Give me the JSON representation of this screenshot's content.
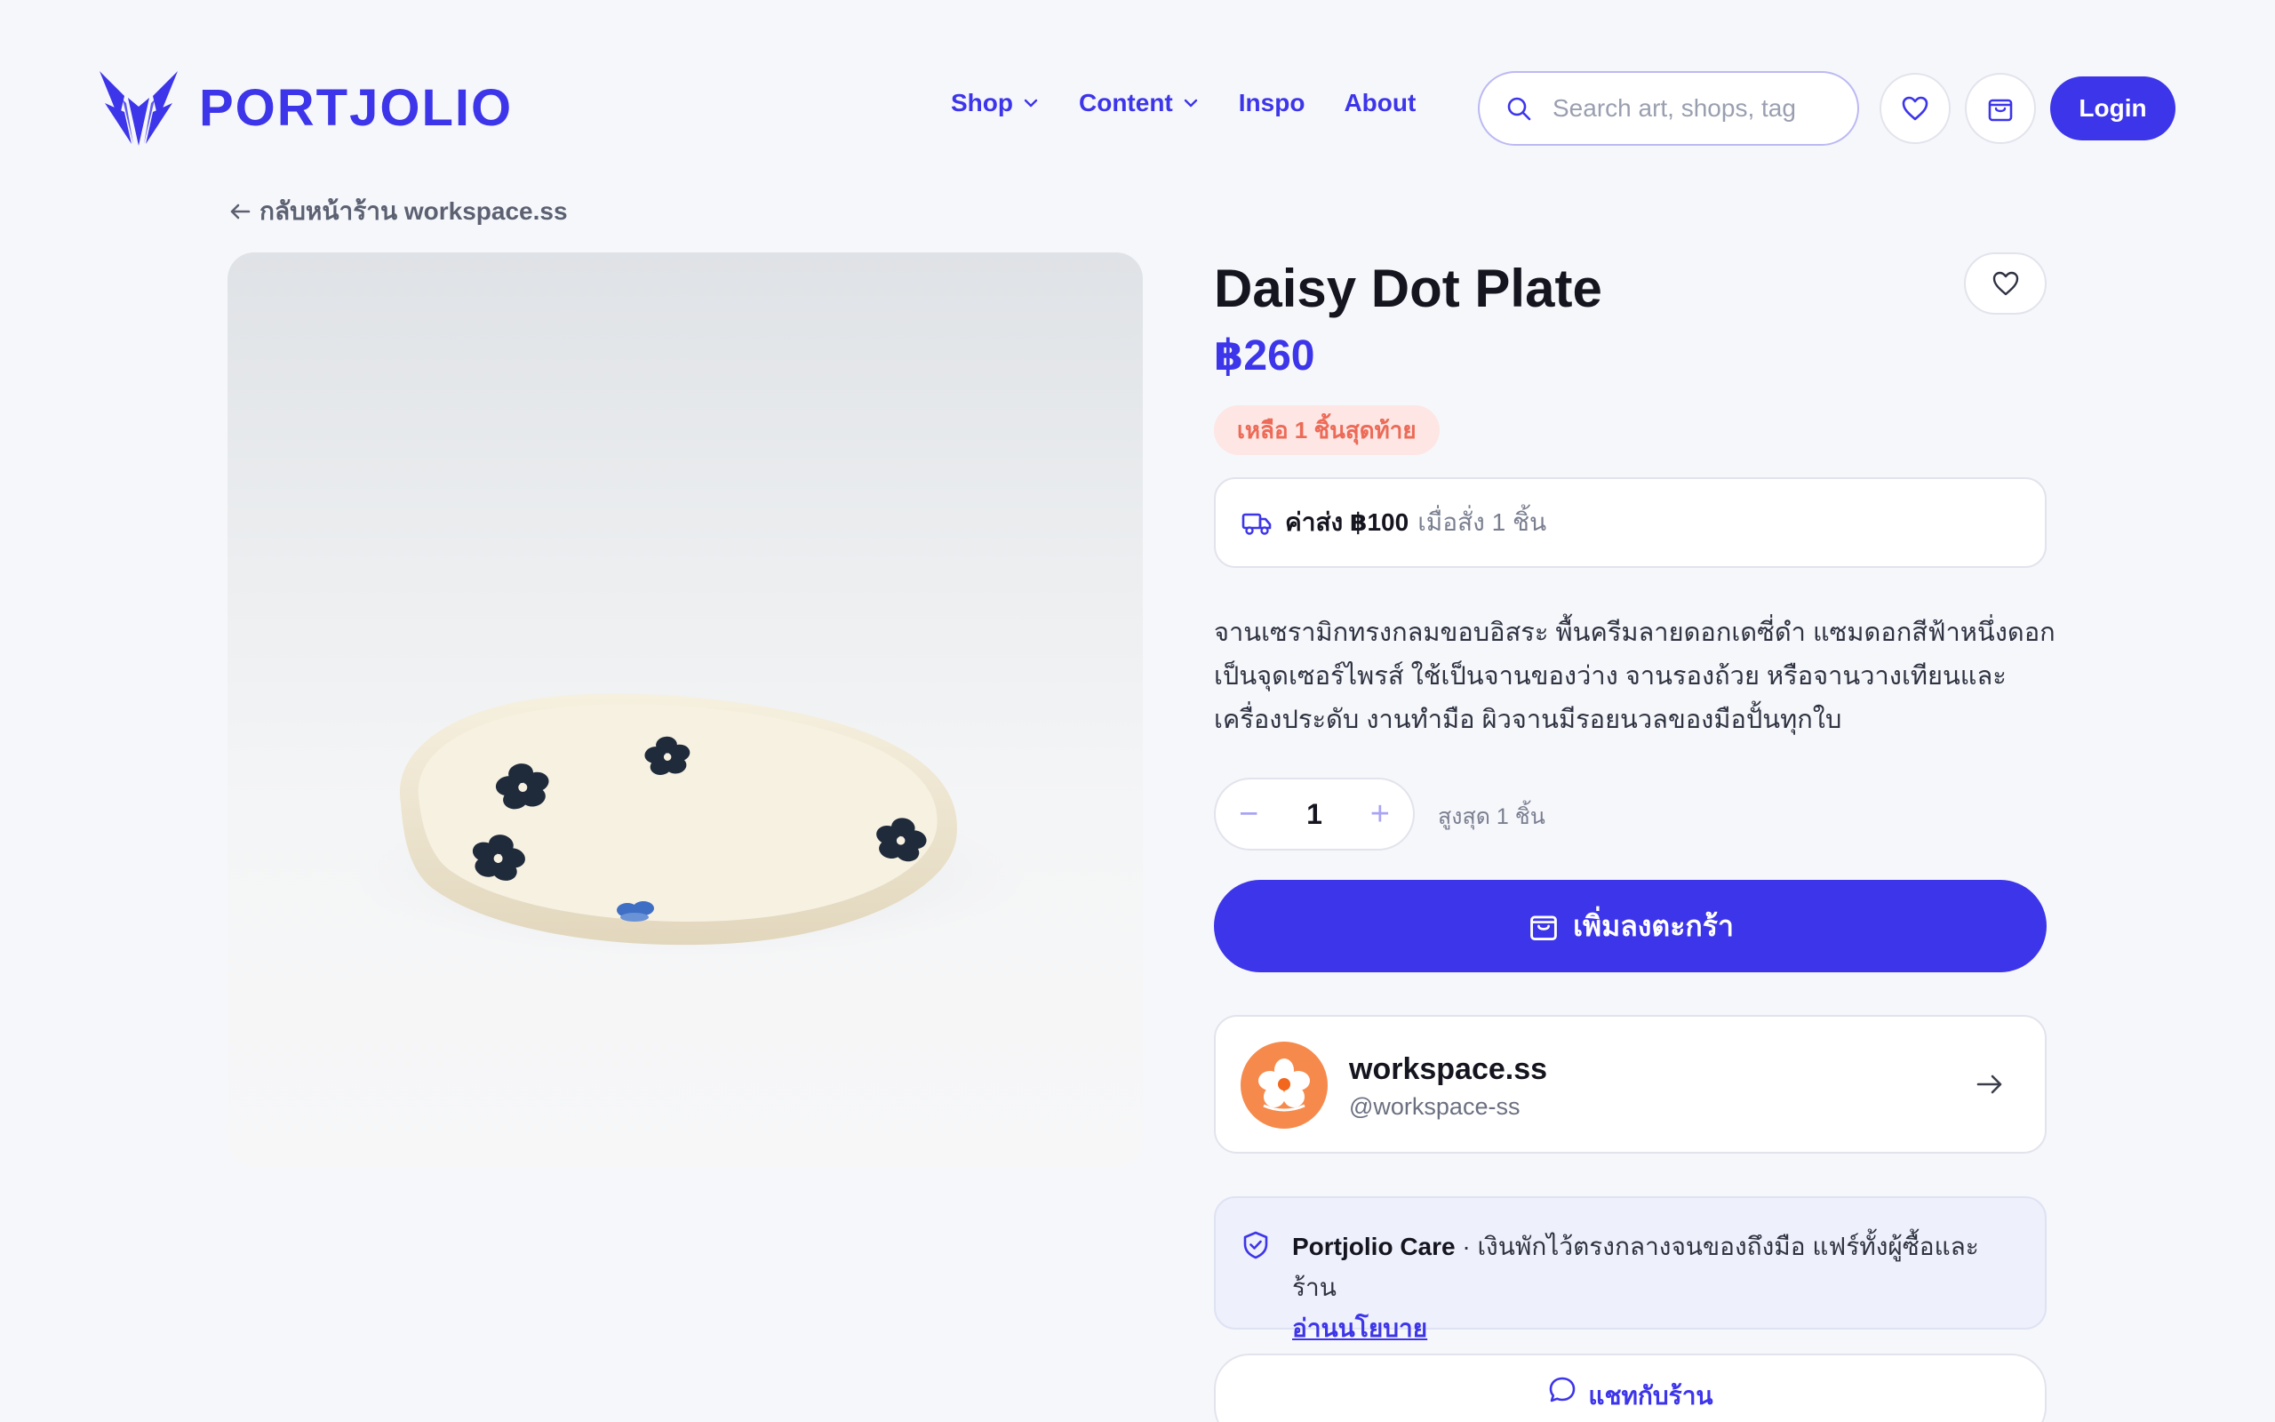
{
  "brand": {
    "name": "PORTJOLIO",
    "color": "#3d35e9"
  },
  "nav": {
    "items": [
      {
        "label": "Shop",
        "has_dropdown": true
      },
      {
        "label": "Content",
        "has_dropdown": true
      },
      {
        "label": "Inspo",
        "has_dropdown": false
      },
      {
        "label": "About",
        "has_dropdown": false
      }
    ]
  },
  "search": {
    "placeholder": "Search art, shops, tag",
    "value": ""
  },
  "header_actions": {
    "wishlist_icon": "heart-icon",
    "cart_icon": "shopping-bag-icon",
    "login_label": "Login"
  },
  "breadcrumb": {
    "back_label": "กลับหน้าร้าน workspace.ss"
  },
  "product": {
    "title": "Daisy Dot Plate",
    "price": "฿260",
    "stock_badge": "เหลือ 1 ชิ้นสุดท้าย",
    "shipping": {
      "fee": "ค่าส่ง ฿100",
      "condition": "เมื่อสั่ง 1 ชิ้น"
    },
    "description": "จานเซรามิกทรงกลมขอบอิสระ พื้นครีมลายดอกเดซี่ดำ แซมดอกสีฟ้าหนึ่งดอกเป็นจุดเซอร์ไพรส์ ใช้เป็นจานของว่าง จานรองถ้วย หรือจานวางเทียนและเครื่องประดับ งานทำมือ ผิวจานมีรอยนวลของมือปั้นทุกใบ",
    "quantity": {
      "value": "1",
      "minus": "−",
      "plus": "+",
      "max_label": "สูงสุด 1 ชิ้น"
    },
    "add_to_cart_label": "เพิ่มลงตะกร้า"
  },
  "shop": {
    "name": "workspace.ss",
    "handle": "@workspace-ss"
  },
  "care": {
    "title": "Portjolio Care",
    "text": " · เงินพักไว้ตรงกลางจนของถึงมือ แฟร์ทั้งผู้ซื้อและร้าน",
    "link_label": "อ่านนโยบาย"
  },
  "chat": {
    "label": "แชทกับร้าน"
  },
  "colors": {
    "accent": "#3d35e9",
    "background": "#f6f7fb",
    "stock_badge_bg": "#fde6e3",
    "stock_badge_text": "#ec6a57",
    "avatar_bg": "#f68a4c"
  }
}
